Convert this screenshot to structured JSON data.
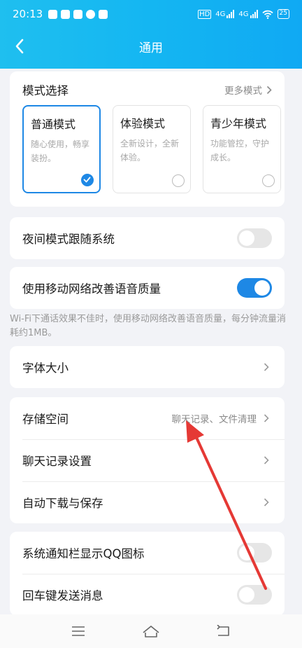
{
  "status_bar": {
    "time": "20:13",
    "net_left": "4G",
    "net_right": "4G",
    "battery": "25",
    "hd": "HD"
  },
  "nav": {
    "title": "通用",
    "back_icon": "chevron-left-icon"
  },
  "mode_section": {
    "title": "模式选择",
    "more_label": "更多模式",
    "modes": [
      {
        "name": "普通模式",
        "desc": "随心使用，畅享装扮。",
        "selected": true
      },
      {
        "name": "体验模式",
        "desc": "全新设计，全新体验。",
        "selected": false
      },
      {
        "name": "青少年模式",
        "desc": "功能管控，守护成长。",
        "selected": false
      }
    ]
  },
  "night_mode": {
    "label": "夜间模式跟随系统",
    "enabled": false
  },
  "voice_quality": {
    "label": "使用移动网络改善语音质量",
    "enabled": true,
    "hint": "Wi-Fi下通话效果不佳时，使用移动网络改善语音质量，每分钟流量消耗约1MB。"
  },
  "font_size": {
    "label": "字体大小"
  },
  "storage_group": {
    "storage_label": "存储空间",
    "storage_value": "聊天记录、文件清理",
    "chat_settings_label": "聊天记录设置",
    "auto_download_label": "自动下载与保存"
  },
  "notify_group": {
    "notify_icon_label": "系统通知栏显示QQ图标",
    "notify_icon_enabled": false,
    "enter_send_label": "回车键发送消息",
    "enter_send_enabled": false
  },
  "bottom_nav": [
    "menu-icon",
    "home-icon",
    "back-icon"
  ],
  "colors": {
    "header": "#14b6f2",
    "accent": "#1e88e5",
    "annotation_arrow": "#e53935"
  }
}
